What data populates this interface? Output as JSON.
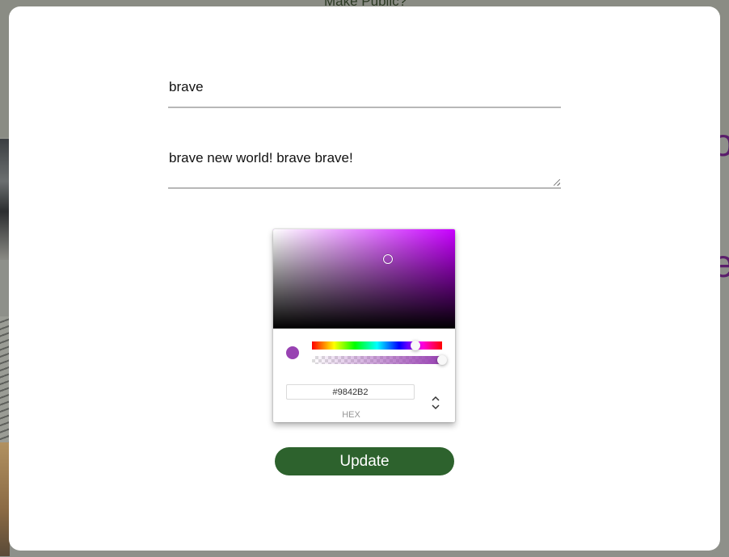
{
  "background": {
    "make_public_label": "Make Public?",
    "heading_fragment_1": "o",
    "heading_fragment_2": "e"
  },
  "form": {
    "title_value": "brave",
    "description_value": "brave new world! brave brave!",
    "update_label": "Update"
  },
  "color_picker": {
    "hex_value": "#9842B2",
    "hex_label": "HEX",
    "hue_color": "#c800ff",
    "saturation_pointer": {
      "saturation_pct": 63,
      "value_pct": 70
    },
    "hue_degrees": 286,
    "alpha_pct": 100,
    "toggle_icon": "chevron-up-down-icon"
  },
  "colors": {
    "accent_button": "#2d622d",
    "selected_color": "#9842B2"
  }
}
